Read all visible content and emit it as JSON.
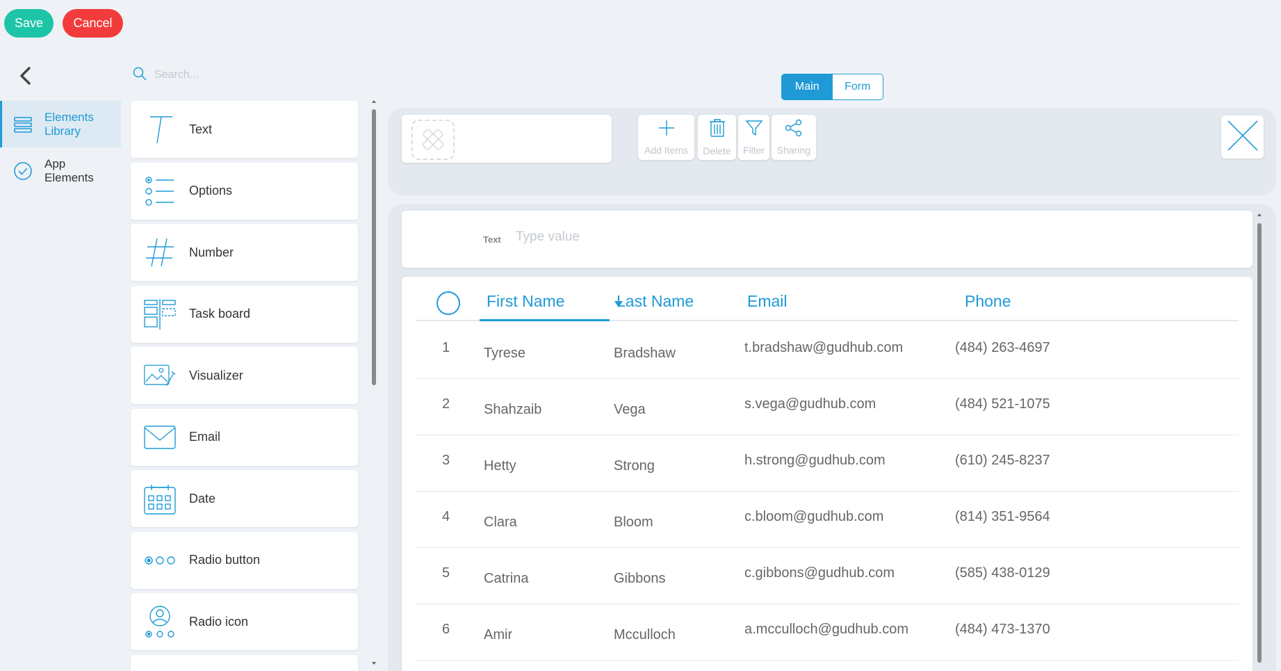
{
  "toolbar": {
    "save_label": "Save",
    "cancel_label": "Cancel"
  },
  "nav": {
    "items": [
      {
        "label": "Elements Library",
        "icon": "layers-icon",
        "active": true
      },
      {
        "label": "App Elements",
        "icon": "check-circle-icon",
        "active": false
      }
    ]
  },
  "search": {
    "placeholder": "Search..."
  },
  "library": {
    "items": [
      {
        "label": "Text",
        "icon": "text-icon"
      },
      {
        "label": "Options",
        "icon": "options-icon"
      },
      {
        "label": "Number",
        "icon": "number-icon"
      },
      {
        "label": "Task board",
        "icon": "task-board-icon"
      },
      {
        "label": "Visualizer",
        "icon": "visualizer-icon"
      },
      {
        "label": "Email",
        "icon": "email-icon"
      },
      {
        "label": "Date",
        "icon": "date-icon"
      },
      {
        "label": "Radio button",
        "icon": "radio-button-icon"
      },
      {
        "label": "Radio icon",
        "icon": "radio-icon-icon"
      }
    ]
  },
  "tabs": {
    "main": "Main",
    "form": "Form",
    "active": "Main"
  },
  "header": {
    "actions": [
      {
        "label": "Add Items",
        "icon": "plus-icon"
      },
      {
        "label": "Delete",
        "icon": "trash-icon"
      },
      {
        "label": "Filter",
        "icon": "filter-icon"
      },
      {
        "label": "Sharing",
        "icon": "share-icon"
      }
    ]
  },
  "text_field": {
    "label": "Text",
    "placeholder": "Type value"
  },
  "table": {
    "columns": [
      "First Name",
      "Last Name",
      "Email",
      "Phone"
    ],
    "rows": [
      {
        "num": "1",
        "first": "Tyrese",
        "last": "Bradshaw",
        "email": "t.bradshaw@gudhub.com",
        "phone": "(484) 263-4697"
      },
      {
        "num": "2",
        "first": "Shahzaib",
        "last": "Vega",
        "email": "s.vega@gudhub.com",
        "phone": "(484) 521-1075"
      },
      {
        "num": "3",
        "first": "Hetty",
        "last": "Strong",
        "email": "h.strong@gudhub.com",
        "phone": "(610) 245-8237"
      },
      {
        "num": "4",
        "first": "Clara",
        "last": "Bloom",
        "email": "c.bloom@gudhub.com",
        "phone": "(814) 351-9564"
      },
      {
        "num": "5",
        "first": "Catrina",
        "last": "Gibbons",
        "email": "c.gibbons@gudhub.com",
        "phone": "(585) 438-0129"
      },
      {
        "num": "6",
        "first": "Amir",
        "last": "Mcculloch",
        "email": "a.mcculloch@gudhub.com",
        "phone": "(484) 473-1370"
      }
    ]
  },
  "colors": {
    "accent": "#1f9ad6",
    "save": "#1ec4a8",
    "cancel": "#f23b3b"
  }
}
